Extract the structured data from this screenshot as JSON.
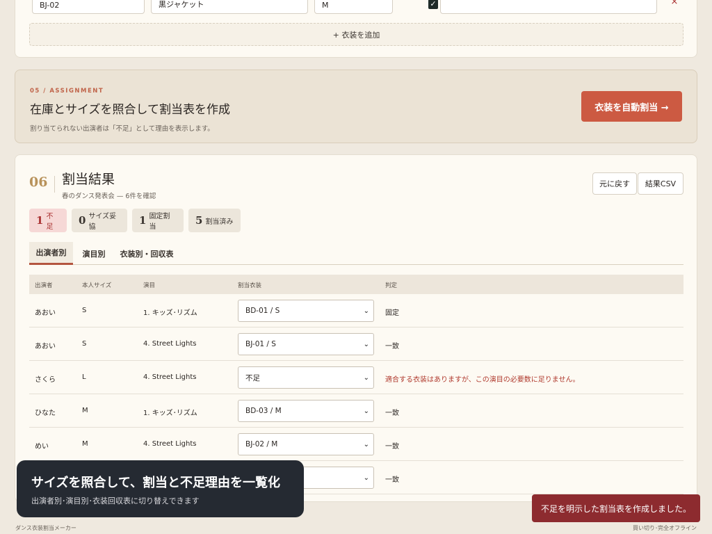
{
  "costume_row": {
    "id": "BJ-02",
    "name": "黒ジャケット",
    "size": "M",
    "checked_mark": "✓",
    "note": "",
    "delete_icon": "×"
  },
  "add_costume_label": "+ 衣装を追加",
  "assignment": {
    "kicker": "05 / ASSIGNMENT",
    "title": "在庫とサイズを照合して割当表を作成",
    "subtitle": "割り当てられない出演者は「不足」として理由を表示します。",
    "auto_button": "衣装を自動割当 →"
  },
  "result": {
    "number": "06",
    "title": "割当結果",
    "subtitle": "春のダンス発表会 — 6件を確認",
    "undo_button": "元に戻す",
    "csv_button": "結果CSV",
    "badges": [
      {
        "count": "1",
        "label": "不足"
      },
      {
        "count": "0",
        "label": "サイズ妥協"
      },
      {
        "count": "1",
        "label": "固定割当"
      },
      {
        "count": "5",
        "label": "割当済み"
      }
    ],
    "tabs": [
      "出演者別",
      "演目別",
      "衣装別・回収表"
    ],
    "columns": [
      "出演者",
      "本人サイズ",
      "演目",
      "割当衣装",
      "判定"
    ],
    "rows": [
      {
        "performer": "あおい",
        "size": "S",
        "program": "1. キッズ･リズム",
        "costume": "BD-01 / S",
        "verdict": "固定"
      },
      {
        "performer": "あおい",
        "size": "S",
        "program": "4. Street Lights",
        "costume": "BJ-01 / S",
        "verdict": "一致"
      },
      {
        "performer": "さくら",
        "size": "L",
        "program": "4. Street Lights",
        "costume": "不足",
        "verdict": "適合する衣装はありますが、この演目の必要数に足りません。"
      },
      {
        "performer": "ひなた",
        "size": "M",
        "program": "1. キッズ･リズム",
        "costume": "BD-03 / M",
        "verdict": "一致"
      },
      {
        "performer": "めい",
        "size": "M",
        "program": "4. Street Lights",
        "costume": "BJ-02 / M",
        "verdict": "一致"
      },
      {
        "performer": "",
        "size": "",
        "program": "",
        "costume": "",
        "verdict": "一致"
      }
    ]
  },
  "tooltip": {
    "heading": "サイズを照合して、割当と不足理由を一覧化",
    "sub": "出演者別･演目別･衣装回収表に切り替えできます"
  },
  "toast": "不足を明示した割当表を作成しました。",
  "footer": {
    "left": "ダンス衣装割当メーカー",
    "right": "買い切り･完全オフライン"
  },
  "colors": {
    "accent": "#cc5a42",
    "toast": "#8d2b2f",
    "warning_text": "#b03a2e",
    "gold": "#b8925a"
  }
}
